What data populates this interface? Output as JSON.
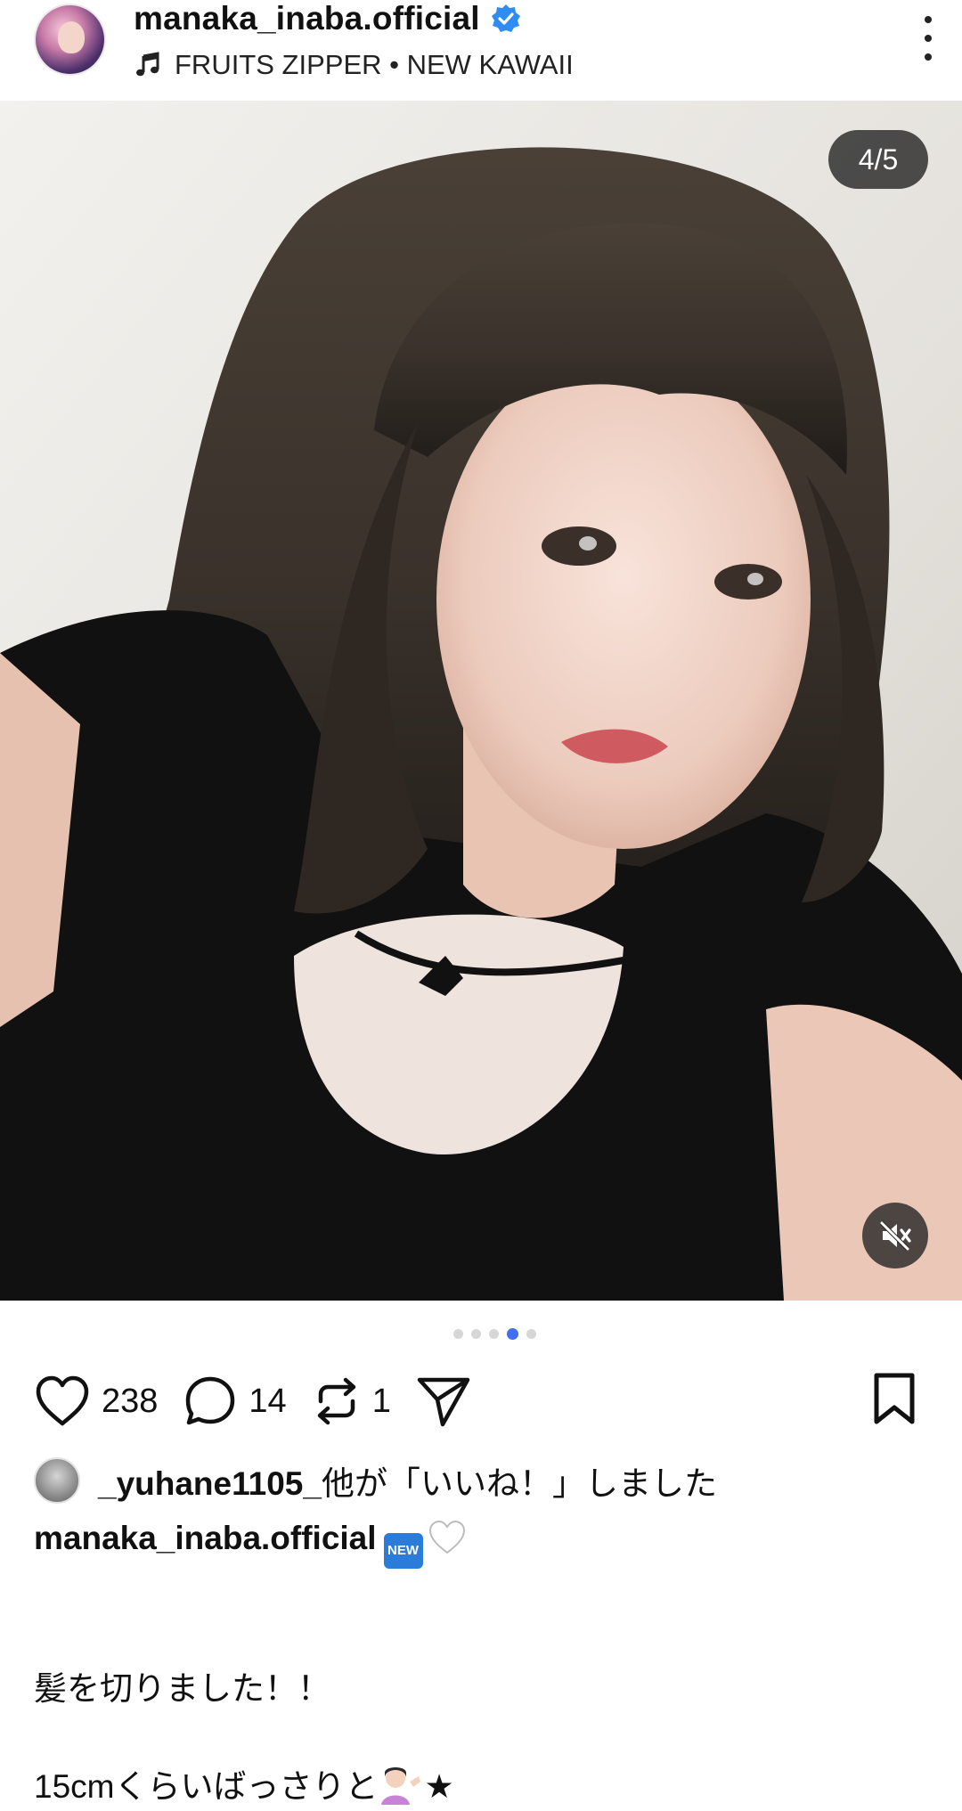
{
  "header": {
    "username": "manaka_inaba.official",
    "music": "FRUITS ZIPPER • NEW KAWAII"
  },
  "media": {
    "counter": "4/5",
    "description": "selfie photo",
    "current_index": 4,
    "total": 5
  },
  "actions": {
    "likes": "238",
    "comments": "14",
    "reposts": "1"
  },
  "liked_by": {
    "user": "_yuhane1105_",
    "suffix": "他が「いいね！」しました"
  },
  "caption": {
    "user": "manaka_inaba.official",
    "badge": "NEW",
    "line1": "",
    "line2": "髪を切りました！！",
    "line3": "",
    "line4": "15cmくらいばっさりと",
    "line4_end": "★"
  },
  "colors": {
    "accent": "#3f6ff2",
    "verified": "#2f8cf5",
    "overlay": "#282828"
  }
}
